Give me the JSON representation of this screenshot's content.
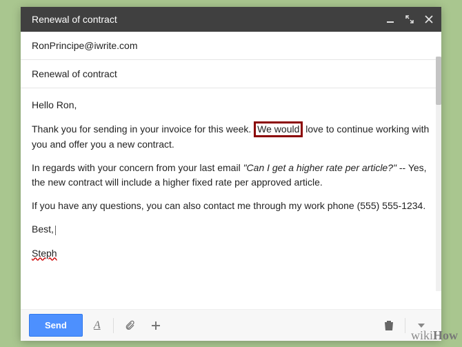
{
  "window": {
    "title": "Renewal of contract"
  },
  "fields": {
    "to": "RonPrincipe@iwrite.com",
    "subject": "Renewal of contract"
  },
  "body": {
    "greeting": "Hello Ron,",
    "p1_a": "Thank you for sending in your invoice for this week. ",
    "p1_highlight": "We would",
    "p1_b": " love to continue working with you and offer you a new contract.",
    "p2_a": "In regards with your concern from your last email ",
    "p2_quote": "\"Can I get a higher rate per article?\"",
    "p2_b": " -- Yes, the new contract will include a higher fixed rate per approved article.",
    "p3": "If you have any questions, you can also contact me through my work phone (555) 555-1234.",
    "signoff": "Best,",
    "signature": "Steph"
  },
  "toolbar": {
    "send": "Send"
  },
  "watermark": {
    "prefix": "wiki",
    "suffix": "How"
  }
}
